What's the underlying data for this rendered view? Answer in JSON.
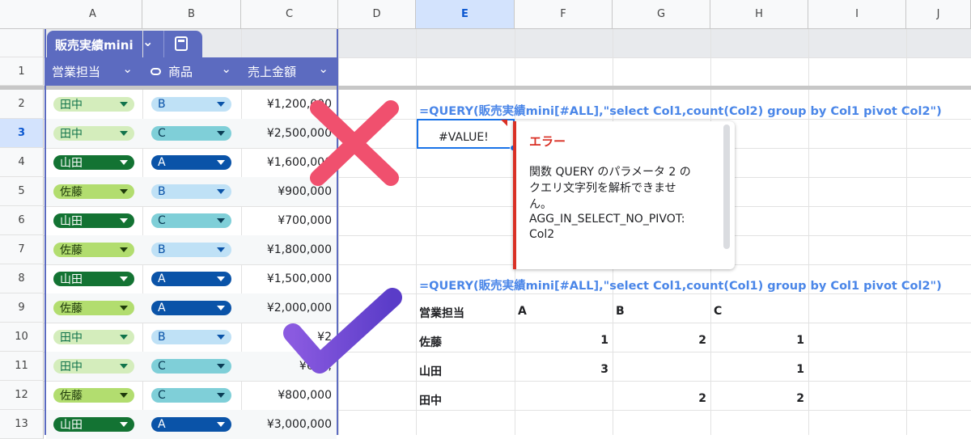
{
  "columns": [
    "A",
    "B",
    "C",
    "D",
    "E",
    "F",
    "G",
    "H",
    "I",
    "J"
  ],
  "selected_column": "E",
  "rows": [
    "1",
    "2",
    "3",
    "4",
    "5",
    "6",
    "7",
    "8",
    "9",
    "10",
    "11",
    "12",
    "13"
  ],
  "selected_row": "3",
  "table": {
    "name": "販売実績mini",
    "headers": [
      "営業担当",
      "商品",
      "売上金額"
    ],
    "records": [
      {
        "person": "田中",
        "product": "B",
        "amount": "¥1,200,000"
      },
      {
        "person": "田中",
        "product": "C",
        "amount": "¥2,500,000"
      },
      {
        "person": "山田",
        "product": "A",
        "amount": "¥1,600,000"
      },
      {
        "person": "佐藤",
        "product": "B",
        "amount": "¥900,000"
      },
      {
        "person": "山田",
        "product": "C",
        "amount": "¥700,000"
      },
      {
        "person": "佐藤",
        "product": "B",
        "amount": "¥1,800,000"
      },
      {
        "person": "山田",
        "product": "A",
        "amount": "¥1,500,000"
      },
      {
        "person": "佐藤",
        "product": "A",
        "amount": "¥2,000,000"
      },
      {
        "person": "田中",
        "product": "B",
        "amount": "¥2"
      },
      {
        "person": "田中",
        "product": "C",
        "amount": "¥600,"
      },
      {
        "person": "佐藤",
        "product": "C",
        "amount": "¥800,000"
      },
      {
        "person": "山田",
        "product": "A",
        "amount": "¥3,000,000"
      }
    ]
  },
  "chip_colors": {
    "田中": {
      "bg": "#d4edbc",
      "fg": "#11734b"
    },
    "佐藤": {
      "bg": "#b2dd6f",
      "fg": "#1e3a0b"
    },
    "山田": {
      "bg": "#137333",
      "fg": "#ffffff"
    },
    "A": {
      "bg": "#0a53a8",
      "fg": "#ffffff"
    },
    "B": {
      "bg": "#bfe1f6",
      "fg": "#0a53a8"
    },
    "C": {
      "bg": "#7fcfd8",
      "fg": "#0a3c55"
    }
  },
  "formula_error": "=QUERY(販売実績mini[#ALL],\"select Col1,count(Col2) group by Col1 pivot Col2\")",
  "error_cell": "#VALUE!",
  "error_popup": {
    "title": "エラー",
    "message_1": "関数 QUERY のパラメータ 2 の",
    "message_2": "クエリ文字列を解析できませ",
    "message_3": "ん。",
    "message_4": "AGG_IN_SELECT_NO_PIVOT:",
    "message_5": "Col2"
  },
  "formula_ok": "=QUERY(販売実績mini[#ALL],\"select Col1,count(Col1) group by Col1 pivot Col2\")",
  "pivot": {
    "header": [
      "営業担当",
      "A",
      "B",
      "C"
    ],
    "rows": [
      [
        "佐藤",
        "1",
        "2",
        "1"
      ],
      [
        "山田",
        "3",
        "",
        "1"
      ],
      [
        "田中",
        "",
        "2",
        "2"
      ]
    ]
  },
  "colors": {
    "error_red": "#d93025",
    "formula_blue": "#4a86e8",
    "table_header": "#5c6bc0",
    "x_mark": "#f0506e",
    "check_mark": "#6a4fd8"
  }
}
